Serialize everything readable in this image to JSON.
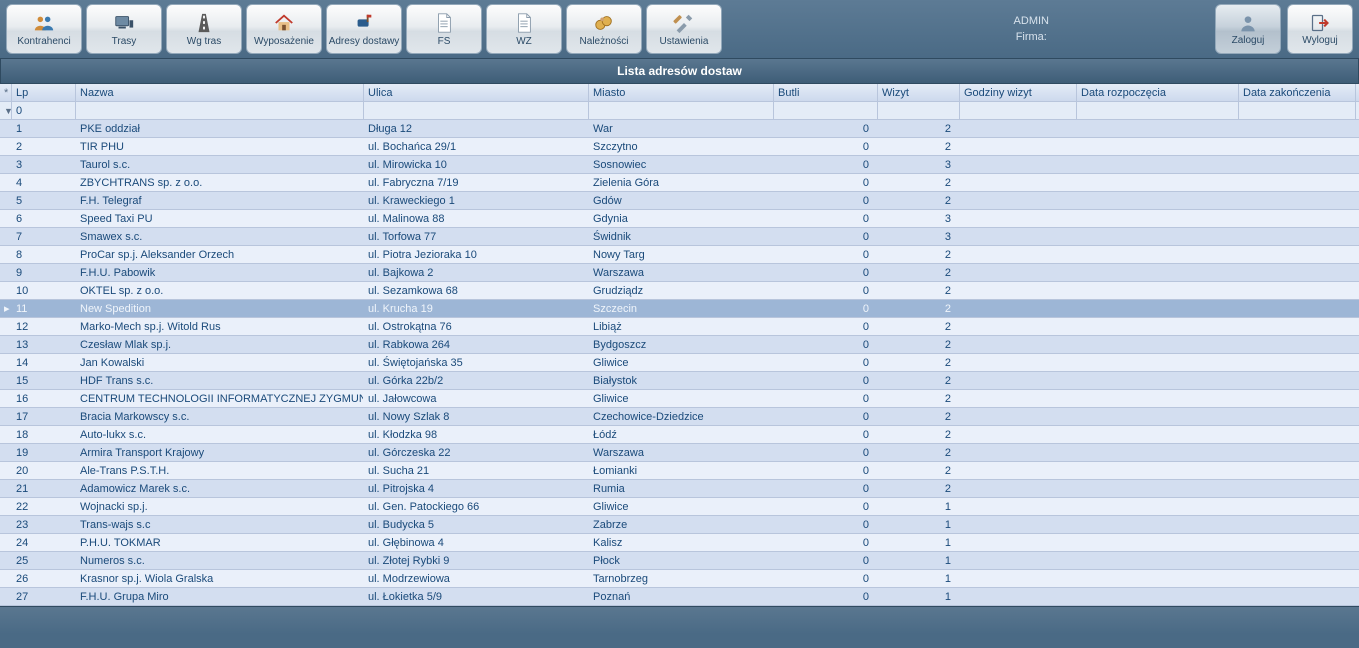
{
  "toolbar": {
    "buttons": [
      {
        "key": "kontrahenci",
        "label": "Kontrahenci",
        "icon": "users"
      },
      {
        "key": "trasy",
        "label": "Trasy",
        "icon": "computer"
      },
      {
        "key": "wgtras",
        "label": "Wg tras",
        "icon": "road"
      },
      {
        "key": "wyposazenie",
        "label": "Wyposażenie",
        "icon": "house"
      },
      {
        "key": "adresy",
        "label": "Adresy dostawy",
        "icon": "mailbox"
      },
      {
        "key": "fs",
        "label": "FS",
        "icon": "doc"
      },
      {
        "key": "wz",
        "label": "WZ",
        "icon": "doc"
      },
      {
        "key": "naleznosci",
        "label": "Należności",
        "icon": "money"
      },
      {
        "key": "ustawienia",
        "label": "Ustawienia",
        "icon": "tools"
      }
    ],
    "user_label": "ADMIN",
    "firma_label": "Firma:",
    "login_label": "Zaloguj",
    "logout_label": "Wyloguj"
  },
  "title": "Lista adresów dostaw",
  "columns": {
    "lp": "Lp",
    "nazwa": "Nazwa",
    "ulica": "Ulica",
    "miasto": "Miasto",
    "butli": "Butli",
    "wizyt": "Wizyt",
    "godz": "Godziny wizyt",
    "droz": "Data rozpoczęcia",
    "dzak": "Data zakończenia"
  },
  "filter": {
    "lp": "0"
  },
  "selected_index": 10,
  "rows": [
    {
      "lp": "1",
      "nazwa": "PKE oddział",
      "ulica": "Długa 12",
      "miasto": "War",
      "butli": "0",
      "wizyt": "2"
    },
    {
      "lp": "2",
      "nazwa": "TIR PHU",
      "ulica": "ul. Bochańca 29/1",
      "miasto": "Szczytno",
      "butli": "0",
      "wizyt": "2"
    },
    {
      "lp": "3",
      "nazwa": "Taurol s.c.",
      "ulica": "ul. Mirowicka 10",
      "miasto": "Sosnowiec",
      "butli": "0",
      "wizyt": "3"
    },
    {
      "lp": "4",
      "nazwa": "ZBYCHTRANS sp. z o.o.",
      "ulica": "ul. Fabryczna 7/19",
      "miasto": "Zielenia Góra",
      "butli": "0",
      "wizyt": "2"
    },
    {
      "lp": "5",
      "nazwa": "F.H. Telegraf",
      "ulica": "ul. Kraweckiego 1",
      "miasto": "Gdów",
      "butli": "0",
      "wizyt": "2"
    },
    {
      "lp": "6",
      "nazwa": "Speed Taxi PU",
      "ulica": "ul. Malinowa 88",
      "miasto": "Gdynia",
      "butli": "0",
      "wizyt": "3"
    },
    {
      "lp": "7",
      "nazwa": "Smawex s.c.",
      "ulica": "ul. Torfowa 77",
      "miasto": "Świdnik",
      "butli": "0",
      "wizyt": "3"
    },
    {
      "lp": "8",
      "nazwa": "ProCar sp.j. Aleksander Orzech",
      "ulica": "ul. Piotra Jezioraka 10",
      "miasto": "Nowy Targ",
      "butli": "0",
      "wizyt": "2"
    },
    {
      "lp": "9",
      "nazwa": "F.H.U. Pabowik",
      "ulica": "ul. Bajkowa 2",
      "miasto": "Warszawa",
      "butli": "0",
      "wizyt": "2"
    },
    {
      "lp": "10",
      "nazwa": "OKTEL sp. z o.o.",
      "ulica": "ul. Sezamkowa 68",
      "miasto": "Grudziądz",
      "butli": "0",
      "wizyt": "2"
    },
    {
      "lp": "11",
      "nazwa": "New Spedition",
      "ulica": "ul. Krucha 19",
      "miasto": "Szczecin",
      "butli": "0",
      "wizyt": "2"
    },
    {
      "lp": "12",
      "nazwa": "Marko-Mech sp.j. Witold Rus",
      "ulica": "ul. Ostrokątna 76",
      "miasto": "Libiąż",
      "butli": "0",
      "wizyt": "2"
    },
    {
      "lp": "13",
      "nazwa": "Czesław Mlak sp.j.",
      "ulica": "ul. Rabkowa 264",
      "miasto": "Bydgoszcz",
      "butli": "0",
      "wizyt": "2"
    },
    {
      "lp": "14",
      "nazwa": "Jan Kowalski",
      "ulica": "ul. Świętojańska 35",
      "miasto": "Gliwice",
      "butli": "0",
      "wizyt": "2"
    },
    {
      "lp": "15",
      "nazwa": "HDF Trans s.c.",
      "ulica": "ul. Górka 22b/2",
      "miasto": "Białystok",
      "butli": "0",
      "wizyt": "2"
    },
    {
      "lp": "16",
      "nazwa": "CENTRUM TECHNOLOGII INFORMATYCZNEJ ZYGMUN",
      "ulica": "ul. Jałowcowa",
      "miasto": "Gliwice",
      "butli": "0",
      "wizyt": "2"
    },
    {
      "lp": "17",
      "nazwa": "Bracia Markowscy s.c.",
      "ulica": "ul. Nowy Szlak 8",
      "miasto": "Czechowice-Dziedzice",
      "butli": "0",
      "wizyt": "2"
    },
    {
      "lp": "18",
      "nazwa": "Auto-lukx s.c.",
      "ulica": "ul. Kłodzka 98",
      "miasto": "Łódź",
      "butli": "0",
      "wizyt": "2"
    },
    {
      "lp": "19",
      "nazwa": "Armira Transport Krajowy",
      "ulica": "ul. Górczeska 22",
      "miasto": "Warszawa",
      "butli": "0",
      "wizyt": "2"
    },
    {
      "lp": "20",
      "nazwa": "Ale-Trans P.S.T.H.",
      "ulica": "ul. Sucha 21",
      "miasto": "Łomianki",
      "butli": "0",
      "wizyt": "2"
    },
    {
      "lp": "21",
      "nazwa": "Adamowicz Marek s.c.",
      "ulica": "ul. Pitrojska 4",
      "miasto": "Rumia",
      "butli": "0",
      "wizyt": "2"
    },
    {
      "lp": "22",
      "nazwa": "Wojnacki sp.j.",
      "ulica": "ul. Gen. Patockiego 66",
      "miasto": "Gliwice",
      "butli": "0",
      "wizyt": "1"
    },
    {
      "lp": "23",
      "nazwa": "Trans-wajs s.c",
      "ulica": "ul. Budycka 5",
      "miasto": "Zabrze",
      "butli": "0",
      "wizyt": "1"
    },
    {
      "lp": "24",
      "nazwa": "P.H.U. TOKMAR",
      "ulica": "ul. Głębinowa 4",
      "miasto": "Kalisz",
      "butli": "0",
      "wizyt": "1"
    },
    {
      "lp": "25",
      "nazwa": "Numeros s.c.",
      "ulica": "ul. Złotej Rybki 9",
      "miasto": "Płock",
      "butli": "0",
      "wizyt": "1"
    },
    {
      "lp": "26",
      "nazwa": "Krasnor sp.j. Wiola Gralska",
      "ulica": "ul. Modrzewiowa",
      "miasto": "Tarnobrzeg",
      "butli": "0",
      "wizyt": "1"
    },
    {
      "lp": "27",
      "nazwa": "F.H.U. Grupa Miro",
      "ulica": "ul. Łokietka 5/9",
      "miasto": "Poznań",
      "butli": "0",
      "wizyt": "1"
    }
  ]
}
